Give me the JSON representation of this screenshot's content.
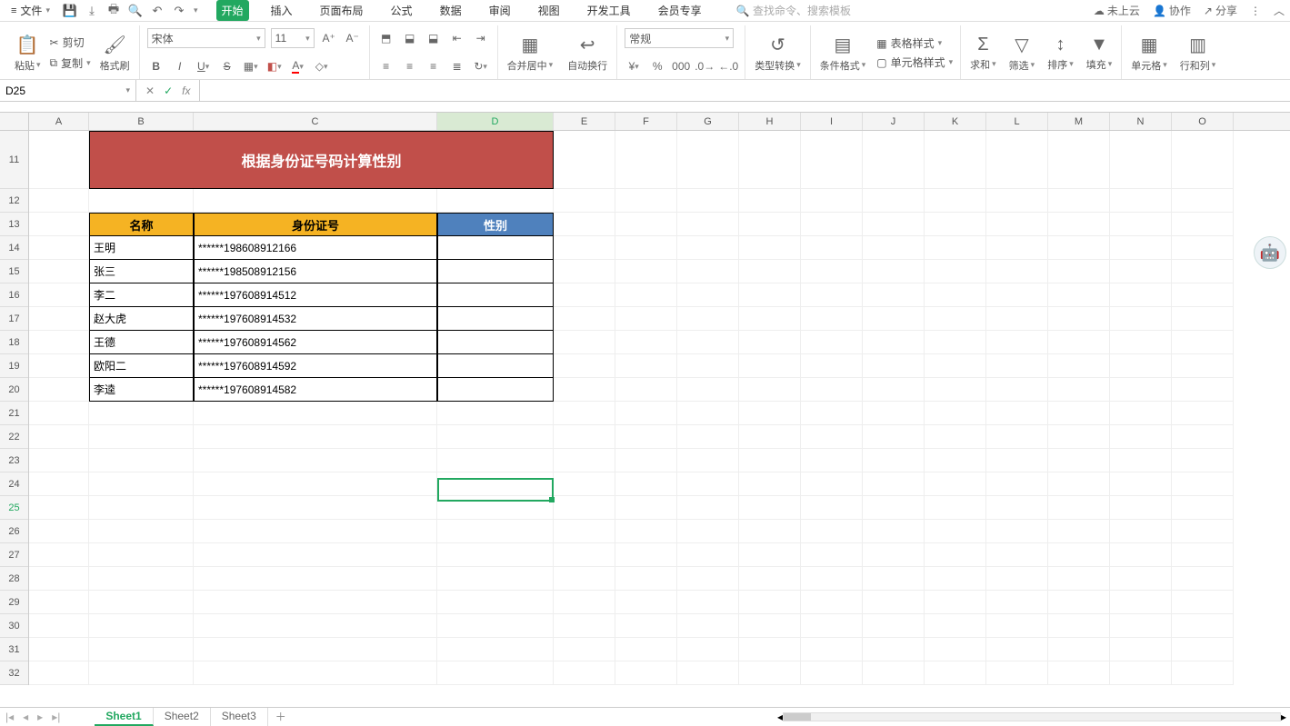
{
  "menubar": {
    "file": "文件",
    "tabs": [
      "开始",
      "插入",
      "页面布局",
      "公式",
      "数据",
      "审阅",
      "视图",
      "开发工具",
      "会员专享"
    ],
    "search_placeholder": "查找命令、搜索模板",
    "cloud": "未上云",
    "collab": "协作",
    "share": "分享"
  },
  "ribbon": {
    "paste": "粘贴",
    "cut": "剪切",
    "copy": "复制",
    "format_painter": "格式刷",
    "font_name": "宋体",
    "font_size": "11",
    "merge": "合并居中",
    "wrap": "自动换行",
    "number_format": "常规",
    "type_convert": "类型转换",
    "cond_fmt": "条件格式",
    "table_style": "表格样式",
    "cell_style": "单元格样式",
    "sum": "求和",
    "filter": "筛选",
    "sort": "排序",
    "fill": "填充",
    "cells": "单元格",
    "rowscols": "行和列"
  },
  "namebox": "D25",
  "columns": [
    "A",
    "B",
    "C",
    "D",
    "E",
    "F",
    "G",
    "H",
    "I",
    "J",
    "K",
    "L",
    "M",
    "N",
    "O"
  ],
  "rows_visible": [
    11,
    12,
    13,
    14,
    15,
    16,
    17,
    18,
    19,
    20,
    21,
    22,
    23,
    24,
    25,
    26,
    27,
    28,
    29,
    30,
    31,
    32
  ],
  "title_text": "根据身份证号码计算性别",
  "headers": {
    "b": "名称",
    "c": "身份证号",
    "d": "性别"
  },
  "rows": [
    {
      "b": "王明",
      "c": "******198608912166",
      "d": ""
    },
    {
      "b": "张三",
      "c": "******198508912156",
      "d": ""
    },
    {
      "b": "李二",
      "c": "******197608914512",
      "d": ""
    },
    {
      "b": "赵大虎",
      "c": "******197608914532",
      "d": ""
    },
    {
      "b": "王德",
      "c": "******197608914562",
      "d": ""
    },
    {
      "b": "欧阳二",
      "c": "******197608914592",
      "d": ""
    },
    {
      "b": "李逵",
      "c": "******197608914582",
      "d": ""
    }
  ],
  "sheets": [
    "Sheet1",
    "Sheet2",
    "Sheet3"
  ],
  "active_cell": "D25"
}
